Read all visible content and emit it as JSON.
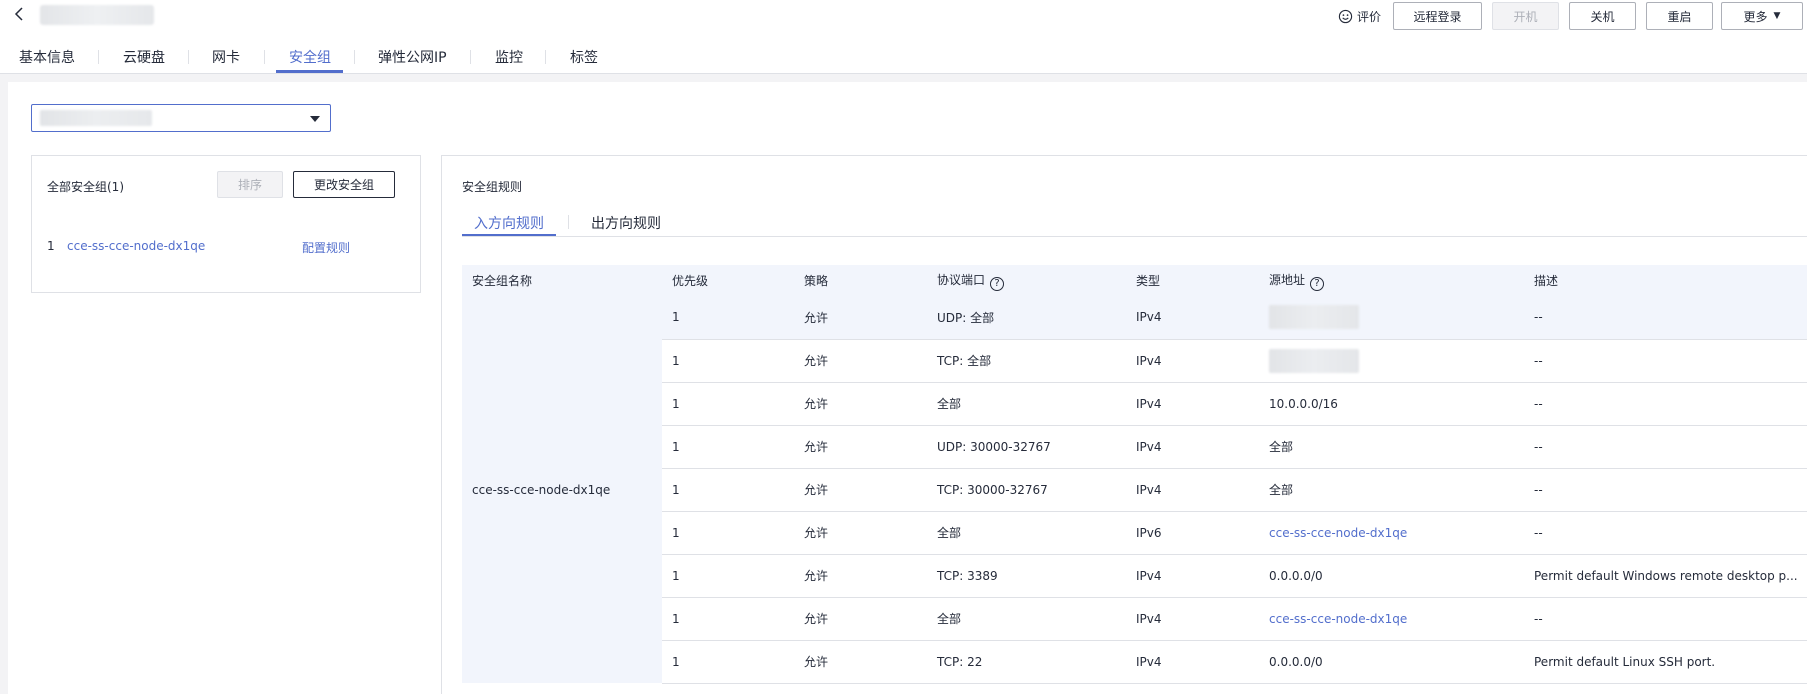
{
  "header": {
    "rate_label": "评价",
    "buttons": {
      "remote_login": "远程登录",
      "start": "开机",
      "shutdown": "关机",
      "restart": "重启",
      "more": "更多"
    }
  },
  "tabs": [
    "基本信息",
    "云硬盘",
    "网卡",
    "安全组",
    "弹性公网IP",
    "监控",
    "标签"
  ],
  "active_tab": "安全组",
  "left_panel": {
    "title": "全部安全组(1)",
    "sort_label": "排序",
    "change_label": "更改安全组",
    "rows": [
      {
        "index": "1",
        "name": "cce-ss-cce-node-dx1qe",
        "action": "配置规则"
      }
    ]
  },
  "rules": {
    "title": "安全组规则",
    "tabs": {
      "inbound": "入方向规则",
      "outbound": "出方向规则"
    },
    "columns": [
      "安全组名称",
      "优先级",
      "策略",
      "协议端口",
      "类型",
      "源地址",
      "描述"
    ],
    "group_name": "cce-ss-cce-node-dx1qe",
    "rows": [
      {
        "priority": "1",
        "policy": "允许",
        "port": "UDP: 全部",
        "type": "IPv4",
        "source": "",
        "source_link": false,
        "desc": "--"
      },
      {
        "priority": "1",
        "policy": "允许",
        "port": "TCP: 全部",
        "type": "IPv4",
        "source": "",
        "source_link": false,
        "desc": "--"
      },
      {
        "priority": "1",
        "policy": "允许",
        "port": "全部",
        "type": "IPv4",
        "source": "10.0.0.0/16",
        "source_link": false,
        "desc": "--"
      },
      {
        "priority": "1",
        "policy": "允许",
        "port": "UDP: 30000-32767",
        "type": "IPv4",
        "source": "全部",
        "source_link": false,
        "desc": "--"
      },
      {
        "priority": "1",
        "policy": "允许",
        "port": "TCP: 30000-32767",
        "type": "IPv4",
        "source": "全部",
        "source_link": false,
        "desc": "--"
      },
      {
        "priority": "1",
        "policy": "允许",
        "port": "全部",
        "type": "IPv6",
        "source": "cce-ss-cce-node-dx1qe",
        "source_link": true,
        "desc": "--"
      },
      {
        "priority": "1",
        "policy": "允许",
        "port": "TCP: 3389",
        "type": "IPv4",
        "source": "0.0.0.0/0",
        "source_link": false,
        "desc": "Permit default Windows remote desktop p..."
      },
      {
        "priority": "1",
        "policy": "允许",
        "port": "全部",
        "type": "IPv4",
        "source": "cce-ss-cce-node-dx1qe",
        "source_link": true,
        "desc": "--"
      },
      {
        "priority": "1",
        "policy": "允许",
        "port": "TCP: 22",
        "type": "IPv4",
        "source": "0.0.0.0/0",
        "source_link": false,
        "desc": "Permit default Linux SSH port."
      }
    ]
  },
  "colors": {
    "accent": "#526ecc",
    "header_bg": "#f2f5fc",
    "border": "#dfe1e6"
  }
}
